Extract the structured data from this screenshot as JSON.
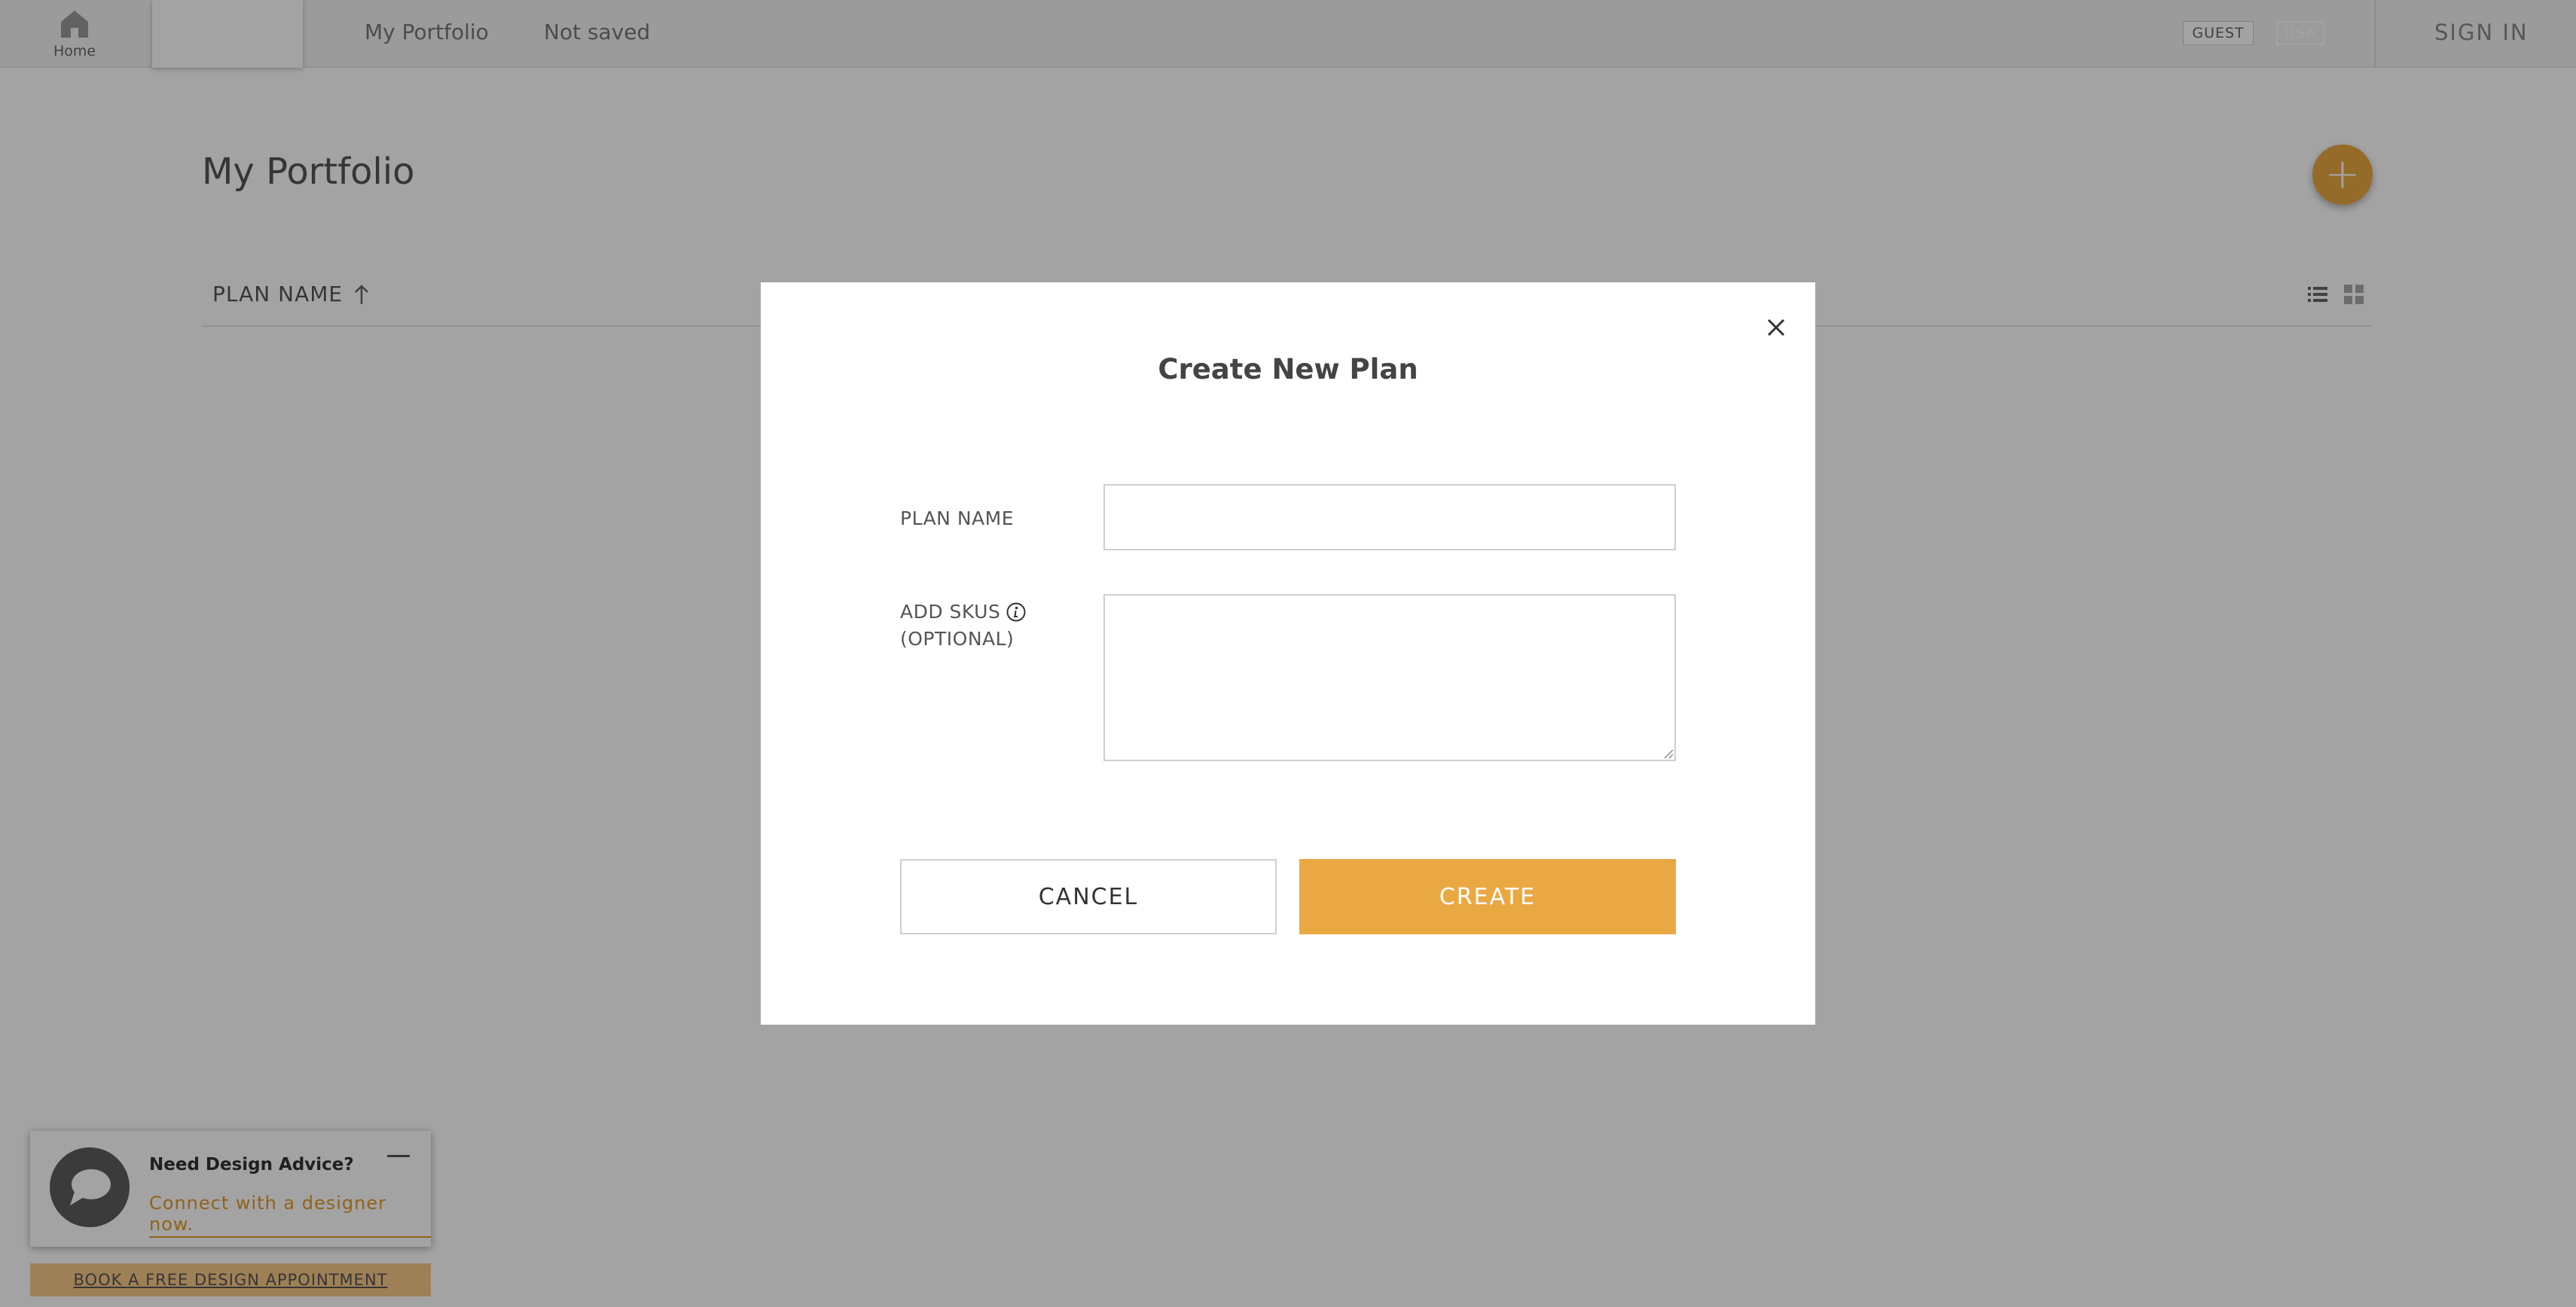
{
  "nav": {
    "home_label": "Home",
    "links": [
      "My Portfolio",
      "Not saved"
    ],
    "guest_badge": "GUEST",
    "country_badge": "USA",
    "sign_in": "SIGN IN"
  },
  "portfolio": {
    "title": "My Portfolio",
    "column_header": "PLAN NAME"
  },
  "modal": {
    "title": "Create New Plan",
    "plan_name_label": "PLAN NAME",
    "plan_name_value": "",
    "skus_label_line1": "ADD SKUS",
    "skus_label_line2": "(OPTIONAL)",
    "skus_value": "",
    "cancel_label": "CANCEL",
    "create_label": "CREATE"
  },
  "chat": {
    "title": "Need Design Advice?",
    "link": "Connect with a designer now.",
    "book_label": "BOOK A FREE DESIGN APPOINTMENT"
  },
  "colors": {
    "accent": "#eaa843",
    "overlay": "rgba(0,0,0,0.36)"
  },
  "icons": [
    "home-icon",
    "plus-icon",
    "sort-up-arrow-icon",
    "list-view-icon",
    "grid-view-icon",
    "chat-bubble-icon",
    "minimize-icon",
    "close-icon",
    "info-icon"
  ]
}
